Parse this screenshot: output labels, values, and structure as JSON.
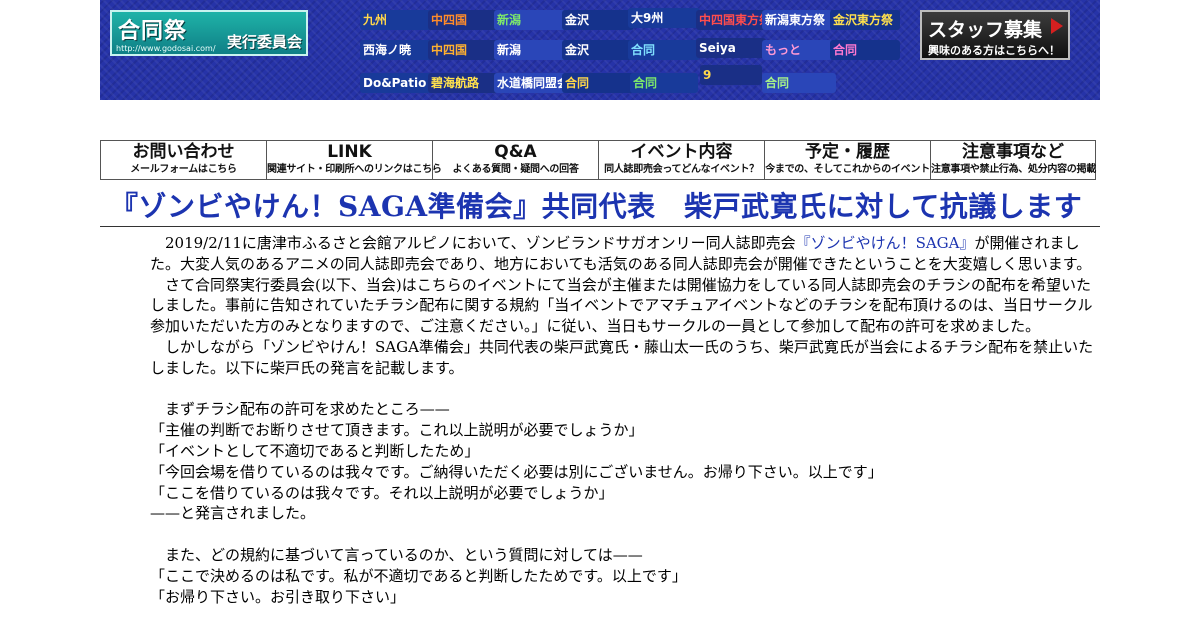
{
  "header": {
    "logo": {
      "main_before": "合同",
      "main_accent": "祭",
      "sub": "実行委員会",
      "url": "http://www.godosai.com/"
    },
    "event_logos": [
      {
        "label": "九州",
        "color": "#ffd84a"
      },
      {
        "label": "中四国",
        "color": "#ff8c2a"
      },
      {
        "label": "新潟",
        "color": "#7de86b"
      },
      {
        "label": "金沢",
        "color": "#ffffff"
      },
      {
        "label": "大9州",
        "color": "#ffffff"
      },
      {
        "label": "中四国東方祭",
        "color": "#ff4d4d"
      },
      {
        "label": "新潟東方祭",
        "color": "#ffffff"
      },
      {
        "label": "金沢東方祭",
        "color": "#ffe14d"
      },
      {
        "label": "西海ノ暁",
        "color": "#ffffff"
      },
      {
        "label": "中四国",
        "color": "#ffb030"
      },
      {
        "label": "新潟",
        "color": "#ffffff"
      },
      {
        "label": "金沢",
        "color": "#ffffff"
      },
      {
        "label": "合同",
        "color": "#7fe0ff"
      },
      {
        "label": "Seiya",
        "color": "#ffffff"
      },
      {
        "label": "もっと",
        "color": "#ff9ad5"
      },
      {
        "label": "合同",
        "color": "#ff7ad0"
      },
      {
        "label": "Do&Patio",
        "color": "#ffffff"
      },
      {
        "label": "碧海航路",
        "color": "#ffe14d"
      },
      {
        "label": "水道橋同盟会",
        "color": "#ffffff"
      },
      {
        "label": "合同",
        "color": "#ffd84a"
      },
      {
        "label": "合同",
        "color": "#7de86b"
      },
      {
        "label": "9",
        "color": "#ffd84a"
      },
      {
        "label": "合同",
        "color": "#a6f08a"
      }
    ],
    "recruit": {
      "title": "スタッフ募集",
      "subtitle": "興味のある方はこちらへ！"
    }
  },
  "nav": [
    {
      "title": "お問い合わせ",
      "sub": "メールフォームはこちら"
    },
    {
      "title": "LINK",
      "sub": "関連サイト・印刷所へのリンクはこちら"
    },
    {
      "title": "Q&A",
      "sub": "よくある質問・疑問への回答"
    },
    {
      "title": "イベント内容",
      "sub": "同人誌即売会ってどんなイベント？"
    },
    {
      "title": "予定・履歴",
      "sub": "今までの、そしてこれからのイベント"
    },
    {
      "title": "注意事項など",
      "sub": "注意事項や禁止行為、処分内容の掲載"
    }
  ],
  "article": {
    "title": "『ゾンビやけん！SAGA準備会』共同代表　柴戸武寛氏に対して抗議します",
    "p1_before": "2019/2/11に唐津市ふるさと会館アルピノにおいて、ゾンビランドサガオンリー同人誌即売会",
    "p1_link": "『ゾンビやけん！SAGA』",
    "p1_after": "が開催されました。大変人気のあるアニメの同人誌即売会であり、地方においても活気のある同人誌即売会が開催できたということを大変嬉しく思います。",
    "p2": "さて合同祭実行委員会(以下、当会)はこちらのイベントにて当会が主催または開催協力をしている同人誌即売会のチラシの配布を希望いたしました。事前に告知されていたチラシ配布に関する規約「当イベントでアマチュアイベントなどのチラシを配布頂けるのは、当日サークル参加いただいた方のみとなりますので、ご注意ください。」に従い、当日もサークルの一員として参加して配布の許可を求めました。",
    "p3": "しかしながら「ゾンビやけん！SAGA準備会」共同代表の柴戸武寛氏・藤山太一氏のうち、柴戸武寛氏が当会によるチラシ配布を禁止いたしました。以下に柴戸氏の発言を記載します。",
    "p4": "まずチラシ配布の許可を求めたところ——",
    "quotes1": [
      "「主催の判断でお断りさせて頂きます。これ以上説明が必要でしょうか」",
      "「イベントとして不適切であると判断したため」",
      "「今回会場を借りているのは我々です。ご納得いただく必要は別にございません。お帰り下さい。以上です」",
      "「ここを借りているのは我々です。それ以上説明が必要でしょうか」"
    ],
    "p5": "——と発言されました。",
    "p6": "また、どの規約に基づいて言っているのか、という質問に対しては——",
    "quotes2": [
      "「ここで決めるのは私です。私が不適切であると判断したためです。以上です」",
      "「お帰り下さい。お引き取り下さい」"
    ]
  }
}
